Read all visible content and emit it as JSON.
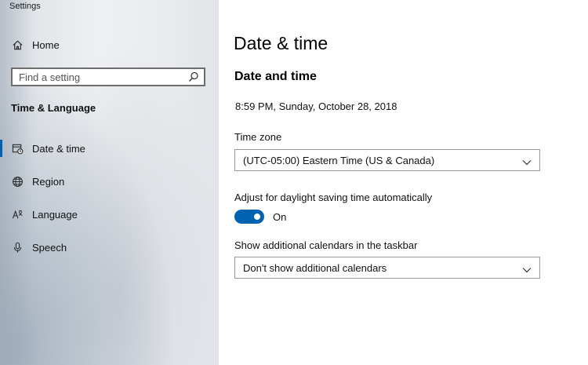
{
  "window": {
    "title": "Settings"
  },
  "sidebar": {
    "home_label": "Home",
    "search_placeholder": "Find a setting",
    "section_heading": "Time & Language",
    "items": [
      {
        "label": "Date & time",
        "icon": "calendar-clock-icon",
        "active": true
      },
      {
        "label": "Region",
        "icon": "globe-icon",
        "active": false
      },
      {
        "label": "Language",
        "icon": "language-icon",
        "active": false
      },
      {
        "label": "Speech",
        "icon": "microphone-icon",
        "active": false
      }
    ]
  },
  "main": {
    "page_title": "Date & time",
    "subheading": "Date and time",
    "current_datetime": "8:59 PM, Sunday, October 28, 2018",
    "timezone": {
      "label": "Time zone",
      "value": "(UTC-05:00) Eastern Time (US & Canada)"
    },
    "dst": {
      "label": "Adjust for daylight saving time automatically",
      "state_label": "On",
      "on": true
    },
    "calendars": {
      "label": "Show additional calendars in the taskbar",
      "value": "Don't show additional calendars"
    }
  },
  "colors": {
    "accent": "#0063b1",
    "border": "#999999"
  }
}
